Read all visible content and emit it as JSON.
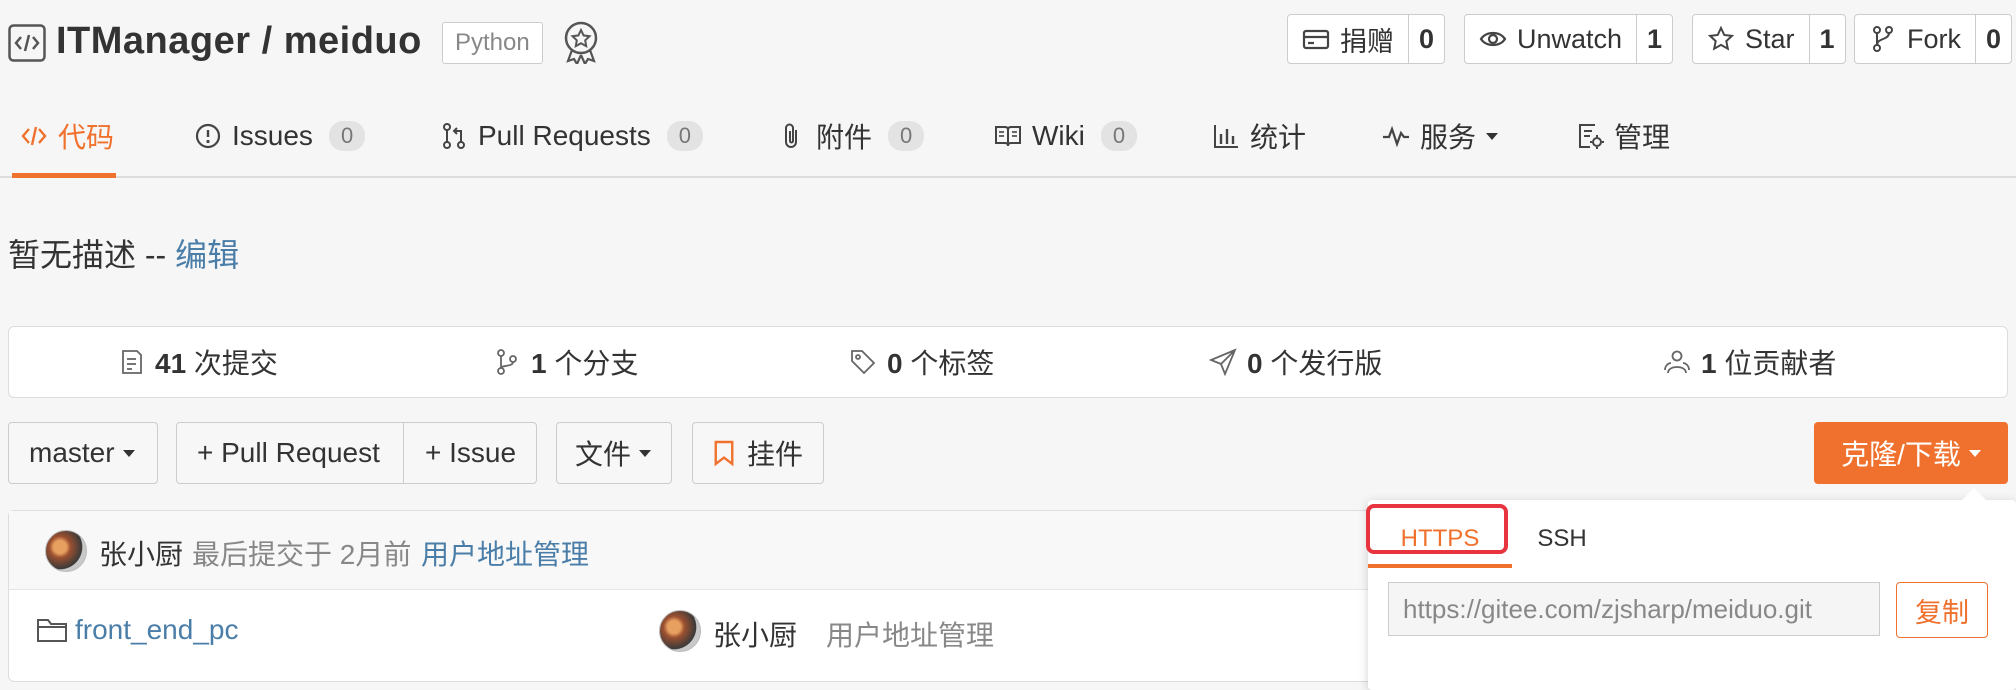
{
  "repo": {
    "title": "ITManager / meiduo",
    "language": "Python"
  },
  "actions": {
    "donate": {
      "label": "捐赠",
      "count": "0"
    },
    "watch": {
      "label": "Unwatch",
      "count": "1"
    },
    "star": {
      "label": "Star",
      "count": "1"
    },
    "fork": {
      "label": "Fork",
      "count": "0"
    }
  },
  "tabs": [
    {
      "label": "代码",
      "icon": "code-icon",
      "active": true
    },
    {
      "label": "Issues",
      "count": "0",
      "icon": "issue-icon"
    },
    {
      "label": "Pull Requests",
      "count": "0",
      "icon": "pull-request-icon"
    },
    {
      "label": "附件",
      "count": "0",
      "icon": "paperclip-icon"
    },
    {
      "label": "Wiki",
      "count": "0",
      "icon": "book-icon"
    },
    {
      "label": "统计",
      "icon": "bar-chart-icon"
    },
    {
      "label": "服务",
      "icon": "pulse-icon"
    },
    {
      "label": "管理",
      "icon": "settings-doc-icon"
    }
  ],
  "description": {
    "text": "暂无描述 -- ",
    "edit_link": "编辑"
  },
  "stats": {
    "commits": {
      "num": "41",
      "label": " 次提交"
    },
    "branches": {
      "num": "1",
      "label": " 个分支"
    },
    "tags": {
      "num": "0",
      "label": " 个标签"
    },
    "releases": {
      "num": "0",
      "label": " 个发行版"
    },
    "contributors": {
      "num": "1",
      "label": " 位贡献者"
    }
  },
  "toolbar": {
    "branch": "master",
    "pull_request": "+ Pull Request",
    "issue": "+ Issue",
    "file": "文件",
    "widget": "挂件",
    "clone": "克隆/下载"
  },
  "last_commit": {
    "author": "张小厨",
    "meta": "最后提交于 2月前",
    "message": "用户地址管理"
  },
  "files": [
    {
      "name": "front_end_pc",
      "author": "张小厨",
      "message": "用户地址管理"
    }
  ],
  "clone_dropdown": {
    "tabs": [
      "HTTPS",
      "SSH"
    ],
    "url": "https://gitee.com/zjsharp/meiduo.git",
    "copy": "复制"
  },
  "colors": {
    "accent": "#f0712d",
    "link": "#4a7ea8",
    "highlight": "#e8343f"
  }
}
